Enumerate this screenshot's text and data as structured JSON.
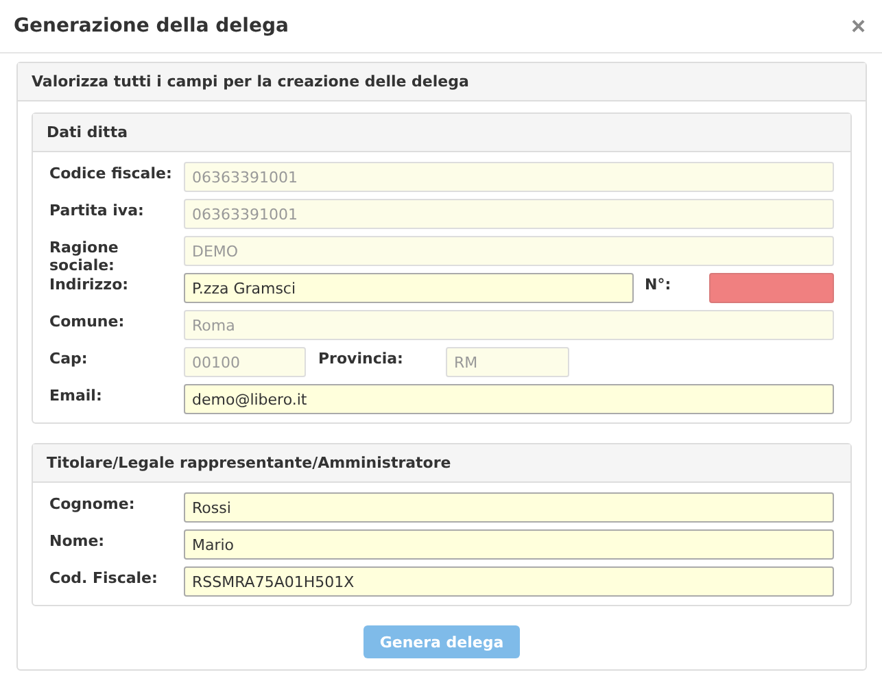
{
  "dialog": {
    "title": "Generazione della delega",
    "close": "×"
  },
  "panel": {
    "title": "Valorizza tutti i campi per la creazione delle delega"
  },
  "sections": [
    {
      "title": "Dati ditta",
      "rows": [
        {
          "kind": "single",
          "fields": [
            {
              "label": "Codice fiscale:",
              "value": "06363391001",
              "disabled": true,
              "invalid": false
            }
          ]
        },
        {
          "kind": "single",
          "fields": [
            {
              "label": "Partita iva:",
              "value": "06363391001",
              "disabled": true,
              "invalid": false
            }
          ]
        },
        {
          "kind": "single",
          "fields": [
            {
              "label": "Ragione sociale:",
              "value": "DEMO",
              "disabled": true,
              "invalid": false
            }
          ]
        },
        {
          "kind": "address",
          "fields": [
            {
              "label": "Indirizzo:",
              "value": "P.zza Gramsci",
              "disabled": false,
              "invalid": false
            },
            {
              "label": "N°:",
              "disabled": false,
              "invalid": true
            }
          ]
        },
        {
          "kind": "single",
          "fields": [
            {
              "label": "Comune:",
              "value": "Roma",
              "disabled": true,
              "invalid": false
            }
          ]
        },
        {
          "kind": "pair",
          "fields": [
            {
              "label": "Cap:",
              "value": "00100",
              "disabled": true,
              "invalid": false
            },
            {
              "label": "Provincia:",
              "value": "RM",
              "disabled": true,
              "invalid": false
            }
          ]
        },
        {
          "kind": "single",
          "fields": [
            {
              "label": "Email:",
              "value": "demo@libero.it",
              "disabled": false,
              "invalid": false
            }
          ]
        }
      ]
    },
    {
      "title": "Titolare/Legale rappresentante/Amministratore",
      "rows": [
        {
          "kind": "single",
          "fields": [
            {
              "label": "Cognome:",
              "value": "Rossi",
              "disabled": false,
              "invalid": false
            }
          ]
        },
        {
          "kind": "single",
          "fields": [
            {
              "label": "Nome:",
              "value": "Mario",
              "disabled": false,
              "invalid": false
            }
          ]
        },
        {
          "kind": "single",
          "fields": [
            {
              "label": "Cod. Fiscale:",
              "value": "RSSMRA75A01H501X",
              "disabled": false,
              "invalid": false
            }
          ]
        }
      ]
    }
  ],
  "submit": {
    "label": "Genera delega",
    "disabled": true
  }
}
